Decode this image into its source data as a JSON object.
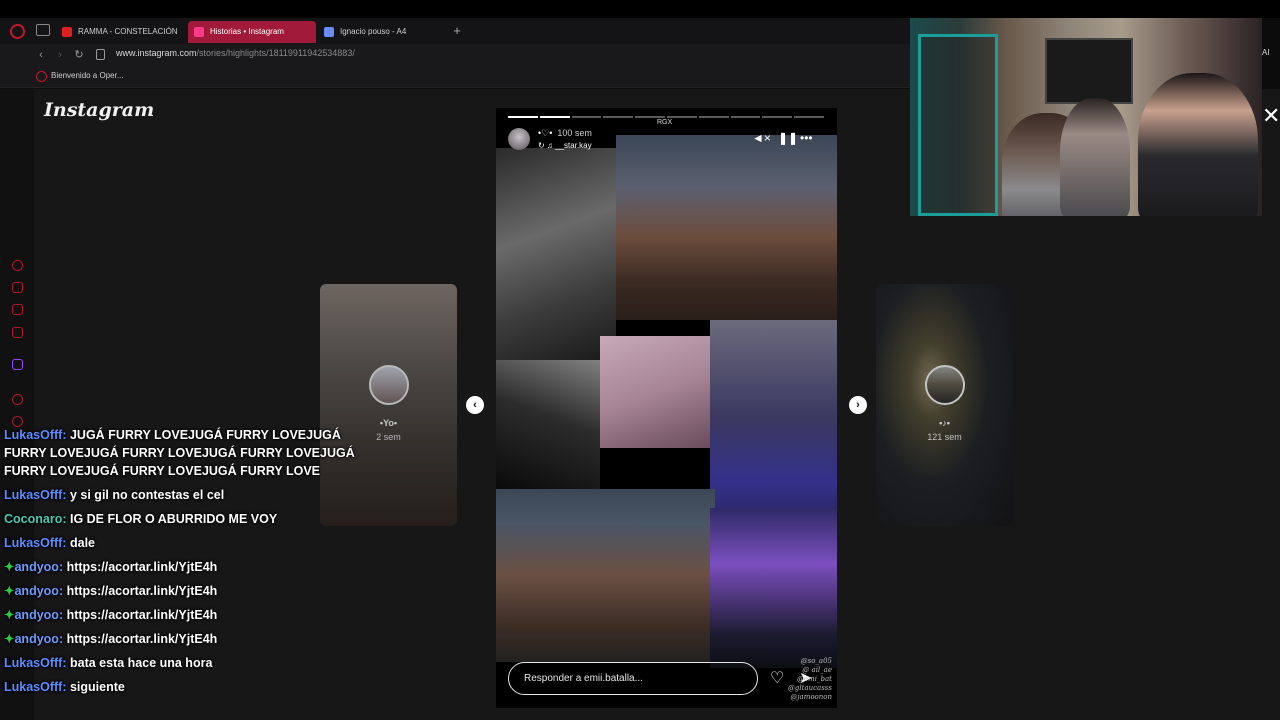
{
  "browser": {
    "tabs": [
      {
        "label": "RAMMA - CONSTELACIÓN",
        "favicon_color": "#e02020"
      },
      {
        "label": "Historias • Instagram",
        "favicon_color": "#ff3a8a"
      },
      {
        "label": "Ignacio pouso - A4",
        "favicon_color": "#6a8cff"
      }
    ],
    "url_host": "www.instagram.com",
    "url_path": "/stories/highlights/18119911942534883/",
    "bookmark": "Bienvenido a Oper...",
    "new_tab_symbol": "+",
    "ai_label": "AI"
  },
  "instagram": {
    "logo": "Instagram",
    "left_preview": {
      "name": "•Yo•",
      "time": "2 sem"
    },
    "right_preview": {
      "name": "•♪•",
      "time": "121 sem"
    },
    "story": {
      "top_label": "RGX",
      "header_title": "•♡•",
      "time": "100 sem",
      "audio": "__star.kay",
      "reply_placeholder": "Responder a emii.batalla...",
      "handles": [
        "@so_a05",
        "@ ail_ae",
        "@emi_bat",
        "@gltaucasss",
        "@jamoonon"
      ]
    }
  },
  "chat": [
    {
      "user": "LukasOfff",
      "color": "#5c8cff",
      "badge": false,
      "text": "JUGÁ FURRY LOVEJUGÁ FURRY LOVEJUGÁ FURRY LOVEJUGÁ FURRY LOVEJUGÁ FURRY LOVEJUGÁ FURRY LOVEJUGÁ FURRY LOVEJUGÁ FURRY LOVE"
    },
    {
      "user": "LukasOfff",
      "color": "#5c8cff",
      "badge": false,
      "text": "y si gil no contestas el cel"
    },
    {
      "user": "Coconaro",
      "color": "#4ec9b0",
      "badge": false,
      "text": "IG DE FLOR O ABURRIDO ME VOY"
    },
    {
      "user": "LukasOfff",
      "color": "#5c8cff",
      "badge": false,
      "text": "dale"
    },
    {
      "user": "andyoo",
      "color": "#6a9cff",
      "badge": true,
      "text": "https://acortar.link/YjtE4h"
    },
    {
      "user": "andyoo",
      "color": "#6a9cff",
      "badge": true,
      "text": "https://acortar.link/YjtE4h"
    },
    {
      "user": "andyoo",
      "color": "#6a9cff",
      "badge": true,
      "text": "https://acortar.link/YjtE4h"
    },
    {
      "user": "andyoo",
      "color": "#6a9cff",
      "badge": true,
      "text": "https://acortar.link/YjtE4h"
    },
    {
      "user": "LukasOfff",
      "color": "#5c8cff",
      "badge": false,
      "text": "bata esta hace una hora"
    },
    {
      "user": "LukasOfff",
      "color": "#5c8cff",
      "badge": false,
      "text": "siguiente"
    }
  ],
  "colors": {
    "accent": "#a11a3a",
    "chrome_bg": "#141416",
    "page_bg": "#171718"
  }
}
